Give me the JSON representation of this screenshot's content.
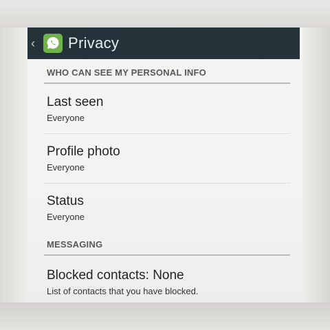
{
  "action_bar": {
    "title": "Privacy",
    "back_glyph": "‹",
    "bar_color": "#24333a"
  },
  "sections": [
    {
      "header": "WHO CAN SEE MY PERSONAL INFO",
      "items": [
        {
          "title": "Last seen",
          "summary": "Everyone"
        },
        {
          "title": "Profile photo",
          "summary": "Everyone"
        },
        {
          "title": "Status",
          "summary": "Everyone"
        }
      ]
    },
    {
      "header": "MESSAGING",
      "items": [
        {
          "title": "Blocked contacts: None",
          "summary": "List of contacts that you have blocked."
        }
      ]
    }
  ],
  "accent_colors": {
    "app_icon": "#6fb24a"
  }
}
